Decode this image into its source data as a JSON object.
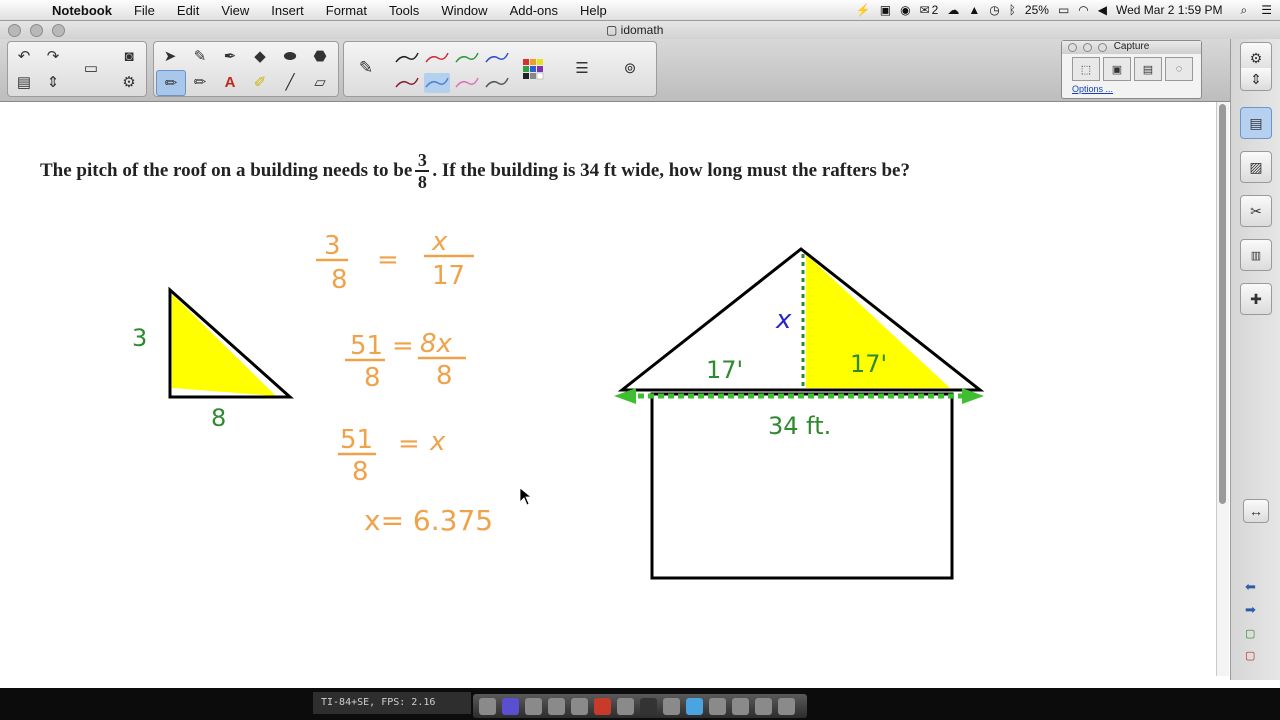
{
  "menubar": {
    "app_name": "Notebook",
    "items": [
      "File",
      "Edit",
      "View",
      "Insert",
      "Format",
      "Tools",
      "Window",
      "Add-ons",
      "Help"
    ],
    "status": {
      "mail_count": "2",
      "battery": "25%",
      "clock": "Wed Mar 2  1:59 PM"
    }
  },
  "window": {
    "title": "idomath"
  },
  "capture_panel": {
    "title": "Capture",
    "options_link": "Options ..."
  },
  "question": {
    "before": "The pitch of the roof on a building needs to be",
    "frac_num": "3",
    "frac_den": "8",
    "after": ". If the building is 34 ft wide, how long must the rafters be?"
  },
  "annotations": {
    "triangle_side": "3",
    "triangle_base": "8",
    "eq1_num_left": "3",
    "eq1_den_left": "8",
    "eq1_equals": "=",
    "eq1_num_right": "x",
    "eq1_den_right": "17",
    "eq2_num_left": "51",
    "eq2_den_left": "8",
    "eq2_equals": "=",
    "eq2_num_right": "8x",
    "eq2_den_right": "8",
    "eq3_num_left": "51",
    "eq3_den_left": "8",
    "eq3_equals": "=",
    "eq3_right": "x",
    "answer": "x= 6.375",
    "half_left": "17'",
    "half_right": "17'",
    "height_var": "x",
    "width_label": "34 ft."
  },
  "status_overlay": {
    "fps_text": "TI-84+SE, FPS: 2.16"
  },
  "colors": {
    "orange": "#f0a24a",
    "green": "#2f8a2f",
    "blue": "#2525c8",
    "yellow": "#ffff00",
    "highlight_green": "#3fbf2f"
  }
}
